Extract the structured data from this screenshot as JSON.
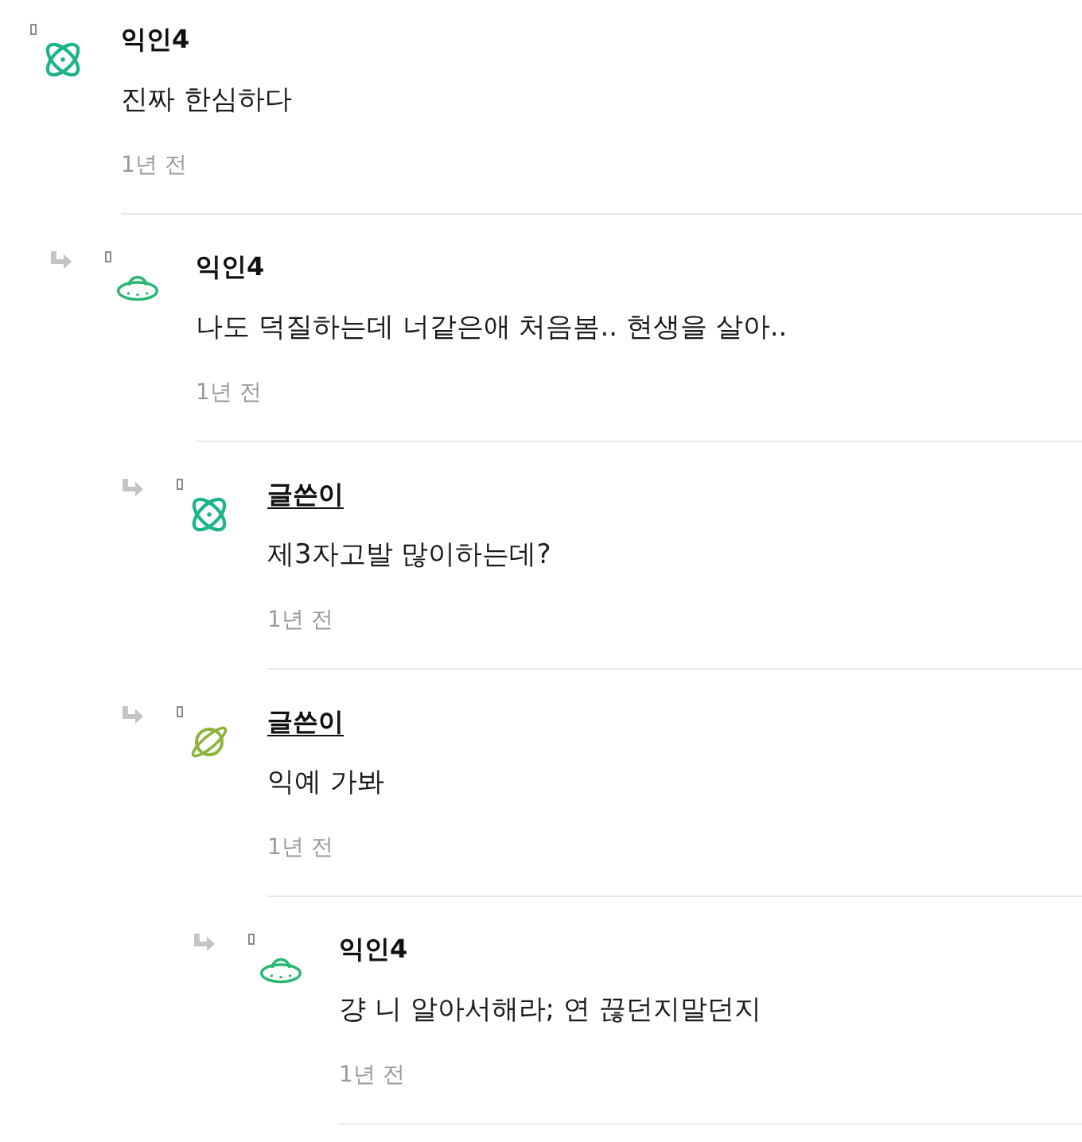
{
  "comments": [
    {
      "kind": "atom",
      "author": "익인4",
      "is_author": false,
      "text": "진짜 한심하다",
      "time": "1년 전",
      "children": [
        {
          "kind": "ufo",
          "author": "익인4",
          "is_author": false,
          "text": "나도 덕질하는데 너같은애 처음봄.. 현생을 살아..",
          "time": "1년 전",
          "children": [
            {
              "kind": "atom",
              "author": "글쓴이",
              "is_author": true,
              "text": "제3자고발 많이하는데?",
              "time": "1년 전"
            },
            {
              "kind": "planet",
              "author": "글쓴이",
              "is_author": true,
              "text": "익예 가봐",
              "time": "1년 전",
              "children": [
                {
                  "kind": "ufo",
                  "author": "익인4",
                  "is_author": false,
                  "text": "걍 니 알아서해라; 연 끊던지말던지",
                  "time": "1년 전"
                }
              ]
            }
          ]
        }
      ]
    }
  ]
}
